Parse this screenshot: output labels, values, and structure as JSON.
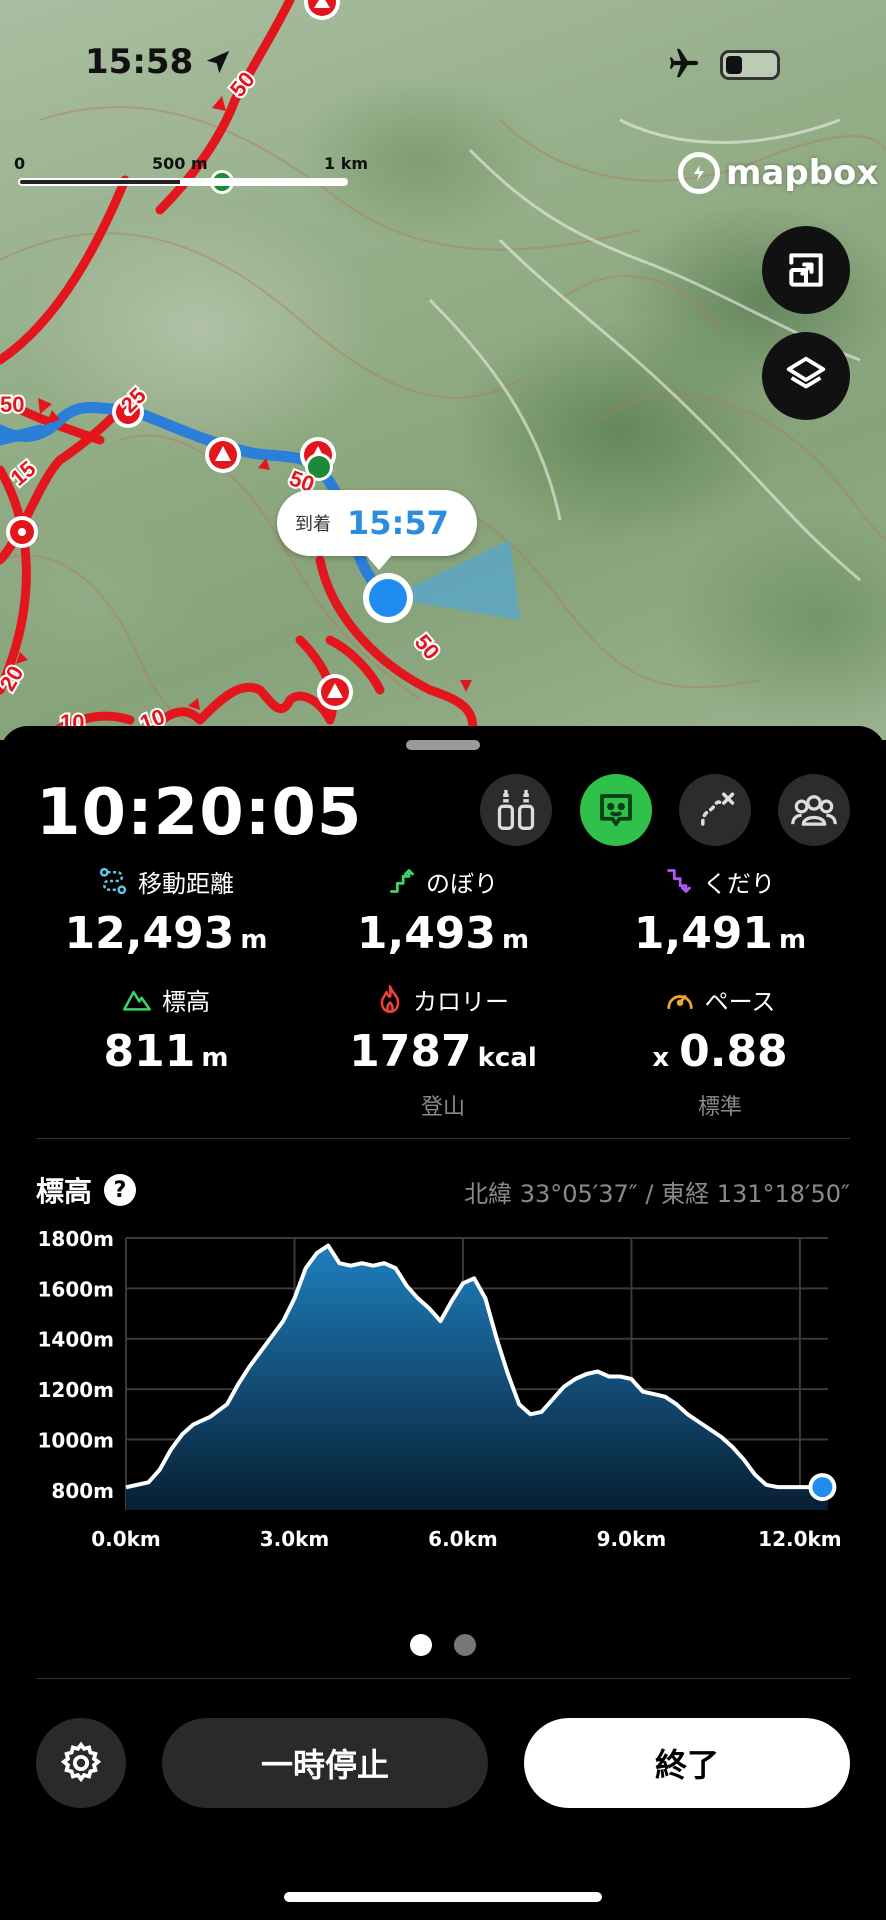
{
  "status_bar": {
    "time": "15:58"
  },
  "map": {
    "scale": {
      "start": "0",
      "mid": "500 m",
      "end": "1 km"
    },
    "attribution": "mapbox",
    "trail_labels": [
      "50",
      "25",
      "15",
      "50",
      "50",
      "20",
      "10",
      "50",
      "10"
    ],
    "arrival": {
      "label": "到着",
      "time": "15:57"
    },
    "buttons": [
      "fullscreen-icon",
      "layers-icon"
    ]
  },
  "panel": {
    "elapsed_time": "10:20:05",
    "stats": {
      "distance": {
        "label": "移動距離",
        "value": "12,493",
        "unit": "m"
      },
      "ascent": {
        "label": "のぼり",
        "value": "1,493",
        "unit": "m"
      },
      "descent": {
        "label": "くだり",
        "value": "1,491",
        "unit": "m"
      },
      "altitude": {
        "label": "標高",
        "value": "811",
        "unit": "m"
      },
      "calories": {
        "label": "カロリー",
        "value": "1787",
        "unit": "kcal",
        "sub": "登山"
      },
      "pace": {
        "label": "ペース",
        "prefix": "x",
        "value": "0.88",
        "sub": "標準"
      }
    },
    "elevation": {
      "title": "標高",
      "help": "?",
      "coordinates": "北緯 33°05′37″ / 東経 131°18′50″"
    },
    "buttons": {
      "pause": "一時停止",
      "finish": "終了"
    },
    "colors": {
      "active_icon": "#2fc14a",
      "route_blue": "#2b8ce0",
      "trail_red": "#e3161d"
    }
  },
  "chart_data": {
    "type": "area",
    "x_unit": "km",
    "y_unit": "m",
    "xlim": [
      0,
      12.5
    ],
    "ylim": [
      720,
      1800
    ],
    "x_ticks": [
      "0.0km",
      "3.0km",
      "6.0km",
      "9.0km",
      "12.0km"
    ],
    "x_tick_values": [
      0,
      3,
      6,
      9,
      12
    ],
    "y_ticks": [
      "1800m",
      "1600m",
      "1400m",
      "1200m",
      "1000m",
      "800m"
    ],
    "y_tick_values": [
      1800,
      1600,
      1400,
      1200,
      1000,
      800
    ],
    "grid": true,
    "x": [
      0,
      0.4,
      0.6,
      0.8,
      1.0,
      1.2,
      1.5,
      1.8,
      2.0,
      2.2,
      2.5,
      2.8,
      3.0,
      3.2,
      3.4,
      3.6,
      3.8,
      4.0,
      4.2,
      4.4,
      4.6,
      4.8,
      5.0,
      5.2,
      5.4,
      5.6,
      5.8,
      6.0,
      6.2,
      6.4,
      6.6,
      6.8,
      7.0,
      7.2,
      7.4,
      7.6,
      7.8,
      8.0,
      8.2,
      8.4,
      8.6,
      8.8,
      9.0,
      9.2,
      9.4,
      9.6,
      9.8,
      10.0,
      10.2,
      10.4,
      10.6,
      10.8,
      11.0,
      11.2,
      11.4,
      11.6,
      11.8,
      12.0,
      12.2,
      12.5
    ],
    "y": [
      810,
      830,
      880,
      960,
      1020,
      1060,
      1090,
      1140,
      1220,
      1290,
      1380,
      1470,
      1560,
      1680,
      1740,
      1770,
      1700,
      1690,
      1700,
      1690,
      1700,
      1680,
      1610,
      1560,
      1520,
      1470,
      1550,
      1620,
      1640,
      1560,
      1400,
      1260,
      1140,
      1100,
      1110,
      1160,
      1210,
      1240,
      1260,
      1270,
      1250,
      1250,
      1240,
      1190,
      1180,
      1170,
      1140,
      1100,
      1070,
      1040,
      1010,
      970,
      920,
      860,
      820,
      811,
      811,
      811,
      811,
      811
    ],
    "current_x": 12.4,
    "current_y": 811
  }
}
